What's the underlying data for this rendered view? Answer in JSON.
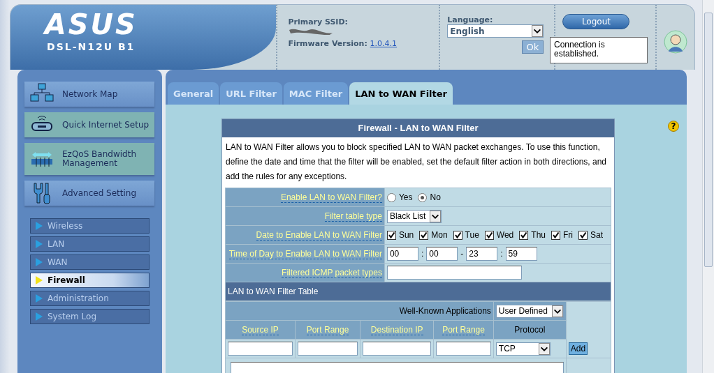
{
  "header": {
    "logo": "ASUS",
    "model": "DSL-N12U B1",
    "ssid_label": "Primary SSID:",
    "firmware_label": "Firmware Version:",
    "firmware_version": "1.0.4.1",
    "language_label": "Language:",
    "language": "English",
    "ok_button": "Ok",
    "logout_button": "Logout",
    "status_tooltip": "Connection is established."
  },
  "sidebar": {
    "items": [
      {
        "label": "Network Map",
        "kind": "section"
      },
      {
        "label": "Quick Internet Setup",
        "kind": "wizard"
      },
      {
        "label": "EzQoS Bandwidth Management",
        "kind": "wizard"
      },
      {
        "label": "Advanced Setting",
        "kind": "section"
      }
    ],
    "subitems": [
      {
        "label": "Wireless",
        "selected": false
      },
      {
        "label": "LAN",
        "selected": false
      },
      {
        "label": "WAN",
        "selected": false
      },
      {
        "label": "Firewall",
        "selected": true
      },
      {
        "label": "Administration",
        "selected": false
      },
      {
        "label": "System Log",
        "selected": false
      }
    ]
  },
  "tabs": [
    {
      "label": "General",
      "selected": false
    },
    {
      "label": "URL Filter",
      "selected": false
    },
    {
      "label": "MAC Filter",
      "selected": false
    },
    {
      "label": "LAN to WAN Filter",
      "selected": true
    }
  ],
  "help_icon": "?",
  "form": {
    "title": "Firewall - LAN to WAN Filter",
    "description": "LAN to WAN Filter allows you to block specified LAN to WAN packet exchanges. To use this function, define the date and time that the filter will be enabled, set the default filter action in both directions, and add the rules for any exceptions.",
    "rows": [
      {
        "label": "Enable LAN to WAN Filter?",
        "kind": "radio",
        "options": [
          {
            "label": "Yes",
            "selected": false
          },
          {
            "label": "No",
            "selected": true
          }
        ]
      },
      {
        "label": "Filter table type",
        "kind": "select",
        "value": "Black List"
      },
      {
        "label": "Date to Enable LAN to WAN Filter",
        "kind": "days",
        "options": [
          {
            "label": "Sun",
            "checked": true
          },
          {
            "label": "Mon",
            "checked": true
          },
          {
            "label": "Tue",
            "checked": true
          },
          {
            "label": "Wed",
            "checked": true
          },
          {
            "label": "Thu",
            "checked": true
          },
          {
            "label": "Fri",
            "checked": true
          },
          {
            "label": "Sat",
            "checked": true
          }
        ]
      },
      {
        "label": "Time of Day to Enable LAN to WAN Filter",
        "kind": "time",
        "values": [
          "00",
          "00",
          "23",
          "59"
        ],
        "separators": [
          ":",
          "-",
          ":"
        ]
      },
      {
        "label": "Filtered ICMP packet types",
        "kind": "text"
      }
    ]
  },
  "filter_table": {
    "title": "LAN to WAN Filter Table",
    "apps_label": "Well-Known Applications",
    "apps_value": "User Defined",
    "columns": [
      {
        "label": "Source IP",
        "kind": "hint"
      },
      {
        "label": "Port Range",
        "kind": "hint"
      },
      {
        "label": "Destination IP",
        "kind": "hint"
      },
      {
        "label": "Port Range",
        "kind": "hint"
      },
      {
        "label": "Protocol",
        "kind": "plain"
      }
    ],
    "protocol": "TCP",
    "add_button": "Add"
  }
}
